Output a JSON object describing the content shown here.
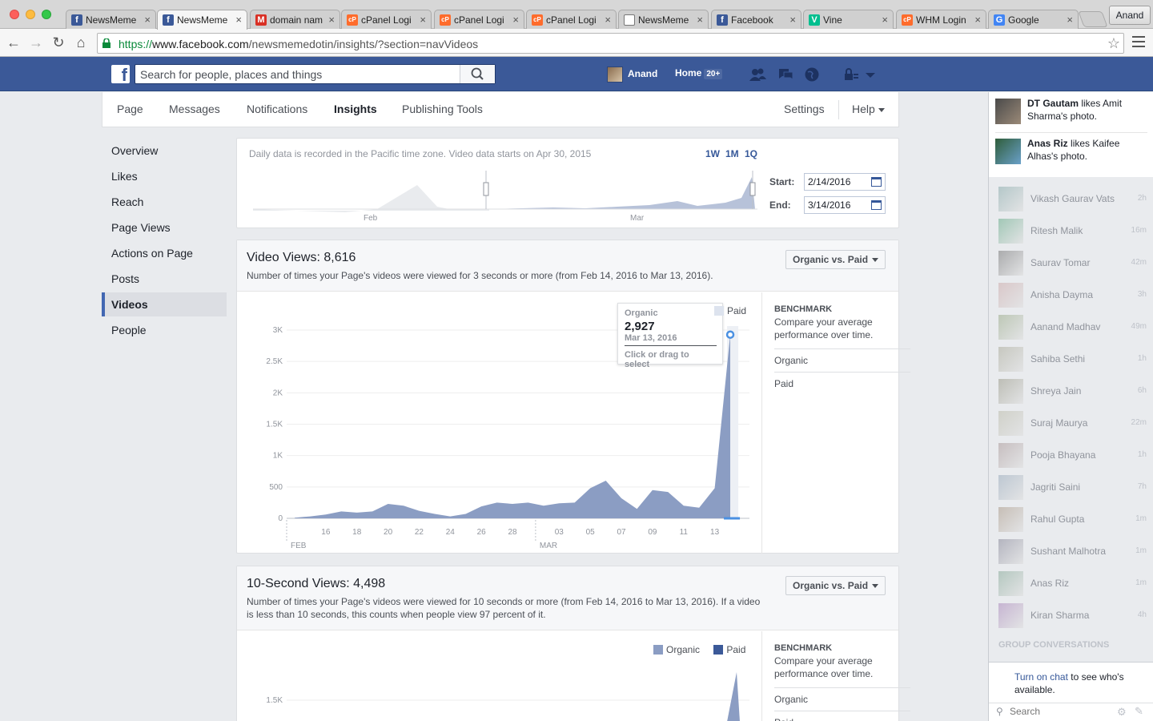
{
  "browser": {
    "tabs": [
      {
        "title": "NewsMeme",
        "icon": "f"
      },
      {
        "title": "NewsMeme",
        "icon": "f"
      },
      {
        "title": "domain nam",
        "icon": "M"
      },
      {
        "title": "cPanel Logi",
        "icon": "cP"
      },
      {
        "title": "cPanel Logi",
        "icon": "cP"
      },
      {
        "title": "cPanel Logi",
        "icon": "cP"
      },
      {
        "title": "NewsMeme",
        "icon": "doc"
      },
      {
        "title": "Facebook",
        "icon": "f"
      },
      {
        "title": "Vine",
        "icon": "V"
      },
      {
        "title": "WHM Login",
        "icon": "cP"
      },
      {
        "title": "Google",
        "icon": "G"
      }
    ],
    "profile": "Anand",
    "url_scheme": "https://",
    "url_host": "www.facebook.com",
    "url_path": "/newsmemedotin/insights/?section=navVideos"
  },
  "fb": {
    "search_placeholder": "Search for people, places and things",
    "user_name": "Anand",
    "home_label": "Home",
    "home_count": "20+"
  },
  "page_nav": {
    "items": [
      "Page",
      "Messages",
      "Notifications",
      "Insights",
      "Publishing Tools"
    ],
    "selected": "Insights",
    "settings": "Settings",
    "help": "Help"
  },
  "left_nav": {
    "items": [
      "Overview",
      "Likes",
      "Reach",
      "Page Views",
      "Actions on Page",
      "Posts",
      "Videos",
      "People"
    ],
    "selected": "Videos"
  },
  "range": {
    "note": "Daily data is recorded in the Pacific time zone. Video data starts on Apr 30, 2015",
    "links": [
      "1W",
      "1M",
      "1Q"
    ],
    "start_label": "Start:",
    "start_value": "2/14/2016",
    "end_label": "End:",
    "end_value": "3/14/2016",
    "month_labels": [
      "Feb",
      "Mar"
    ]
  },
  "video_views": {
    "title": "Video Views: 8,616",
    "description": "Number of times your Page's videos were viewed for 3 seconds or more (from Feb 14, 2016 to Mar 13, 2016).",
    "dropdown": "Organic vs. Paid",
    "legend": [
      "Organic",
      "Paid"
    ],
    "tooltip": {
      "label": "Organic",
      "value": "2,927",
      "date": "Mar 13, 2016",
      "hint": "Click or drag to select"
    },
    "benchmark": {
      "title": "BENCHMARK",
      "desc": "Compare your average performance over time.",
      "rows": [
        "Organic",
        "Paid"
      ]
    }
  },
  "ten_second": {
    "title": "10-Second Views: 4,498",
    "description": "Number of times your Page's videos were viewed for 10 seconds or more (from Feb 14, 2016 to Mar 13, 2016). If a video is less than 10 seconds, this counts when people view 97 percent of it.",
    "dropdown": "Organic vs. Paid",
    "legend": [
      "Organic",
      "Paid"
    ],
    "benchmark": {
      "title": "BENCHMARK",
      "desc": "Compare your average performance over time.",
      "rows": [
        "Organic",
        "Paid"
      ]
    }
  },
  "chart_data": [
    {
      "type": "area",
      "x": [
        "FEB 14",
        "15",
        "16",
        "17",
        "18",
        "19",
        "20",
        "21",
        "22",
        "23",
        "24",
        "25",
        "26",
        "27",
        "28",
        "29",
        "MAR 01",
        "02",
        "03",
        "04",
        "05",
        "06",
        "07",
        "08",
        "09",
        "10",
        "11",
        "12",
        "13"
      ],
      "x_tick_labels": [
        "16",
        "18",
        "20",
        "22",
        "24",
        "26",
        "28",
        "03",
        "05",
        "07",
        "09",
        "11",
        "13"
      ],
      "x_month_labels": [
        "FEB",
        "MAR"
      ],
      "series": [
        {
          "name": "Organic",
          "values": [
            10,
            30,
            60,
            110,
            90,
            110,
            230,
            200,
            120,
            70,
            30,
            70,
            190,
            250,
            230,
            250,
            200,
            240,
            250,
            480,
            600,
            320,
            150,
            450,
            420,
            200,
            170,
            480,
            2927
          ],
          "color": "#8b9dc3"
        },
        {
          "name": "Paid",
          "values": [
            0,
            0,
            0,
            0,
            0,
            0,
            0,
            0,
            0,
            0,
            0,
            0,
            0,
            0,
            0,
            0,
            0,
            0,
            0,
            0,
            0,
            0,
            0,
            0,
            0,
            0,
            0,
            0,
            0
          ],
          "color": "#3b5998"
        }
      ],
      "y_tick_labels": [
        "0",
        "500",
        "1K",
        "1.5K",
        "2K",
        "2.5K",
        "3K"
      ],
      "ylim": [
        0,
        3000
      ]
    },
    {
      "type": "area",
      "series": [
        {
          "name": "Organic",
          "color": "#8b9dc3"
        },
        {
          "name": "Paid",
          "color": "#3b5998"
        }
      ],
      "y_tick_labels": [
        "1.5K"
      ]
    }
  ],
  "chat": {
    "ticker": [
      {
        "actor": "DT Gautam",
        "text": " likes Amit Sharma's photo."
      },
      {
        "actor": "Anas Riz",
        "text": " likes Kaifee Alhas's photo."
      }
    ],
    "friends": [
      {
        "name": "Vikash Gaurav Vats",
        "time": "2h"
      },
      {
        "name": "Ritesh Malik",
        "time": "16m"
      },
      {
        "name": "Saurav Tomar",
        "time": "42m"
      },
      {
        "name": "Anisha Dayma",
        "time": "3h"
      },
      {
        "name": "Aanand Madhav",
        "time": "49m"
      },
      {
        "name": "Sahiba Sethi",
        "time": "1h"
      },
      {
        "name": "Shreya Jain",
        "time": "6h"
      },
      {
        "name": "Suraj Maurya",
        "time": "22m"
      },
      {
        "name": "Pooja Bhayana",
        "time": "1h"
      },
      {
        "name": "Jagriti Saini",
        "time": "7h"
      },
      {
        "name": "Rahul Gupta",
        "time": "1m"
      },
      {
        "name": "Sushant Malhotra",
        "time": "1m"
      },
      {
        "name": "Anas Riz",
        "time": "1m"
      },
      {
        "name": "Kiran Sharma",
        "time": "4h"
      }
    ],
    "group_label": "GROUP CONVERSATIONS",
    "turn_on_link": "Turn on chat",
    "turn_on_rest": " to see who's available.",
    "search_placeholder": "Search"
  }
}
